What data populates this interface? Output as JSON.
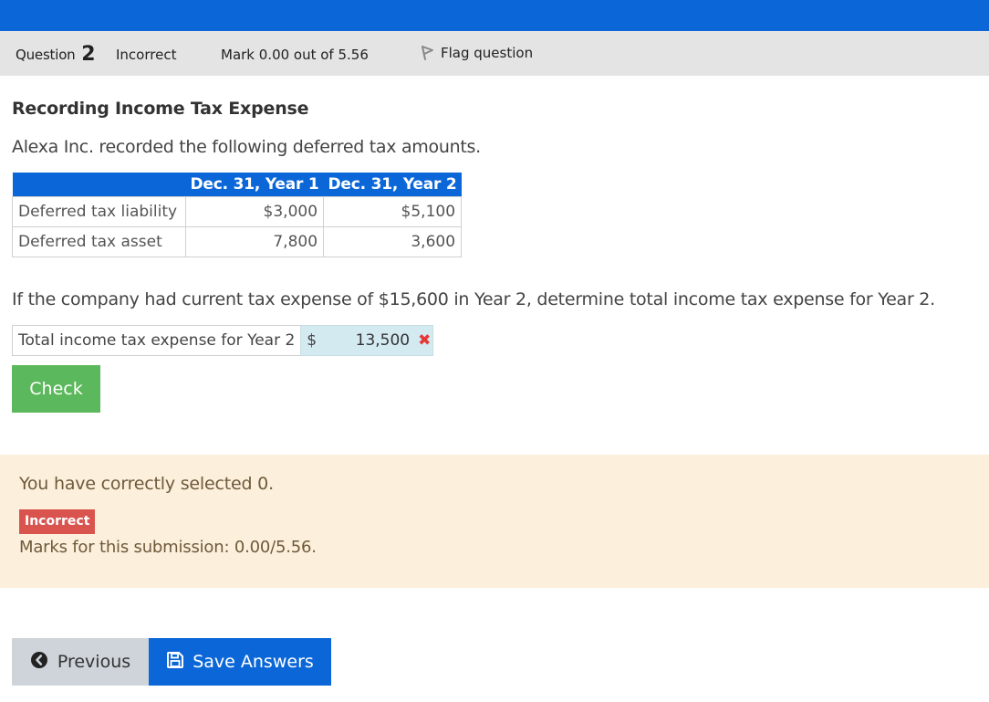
{
  "colors": {
    "brand": "#0b67d8",
    "info_bar": "#e4e4e4",
    "check_button": "#5cb85c",
    "feedback_bg": "#fcefdc",
    "incorrect_badge": "#d9534f",
    "incorrect_mark": "#e53935",
    "answer_field_bg": "#d4eaf1",
    "previous_button": "#ced4da"
  },
  "question_info": {
    "label": "Question",
    "number": "2",
    "state": "Incorrect",
    "grade": "Mark 0.00 out of 5.56",
    "flag_label": "Flag question",
    "flag_icon": "flag-icon"
  },
  "question": {
    "title": "Recording Income Tax Expense",
    "intro": "Alexa Inc. recorded the following deferred tax amounts.",
    "table": {
      "headers": [
        "",
        "Dec. 31, Year 1",
        "Dec. 31, Year 2"
      ],
      "rows": [
        {
          "label": "Deferred tax liability",
          "year1": "$3,000",
          "year2": "$5,100"
        },
        {
          "label": "Deferred tax asset",
          "year1": "7,800",
          "year2": "3,600"
        }
      ]
    },
    "prompt": "If the company had current tax expense of $15,600 in Year 2, determine total income tax expense for Year 2.",
    "answer": {
      "label": "Total income tax expense for Year 2",
      "currency": "$",
      "value": "13,500",
      "status_icon": "incorrect-x-icon",
      "status_glyph": "✖"
    },
    "check_label": "Check"
  },
  "feedback": {
    "selected_text": "You have correctly selected 0.",
    "badge": "Incorrect",
    "marks_text": "Marks for this submission: 0.00/5.56."
  },
  "navigation": {
    "previous_label": "Previous",
    "previous_icon": "chevron-left-circle-icon",
    "save_label": "Save Answers",
    "save_icon": "floppy-disk-icon"
  }
}
